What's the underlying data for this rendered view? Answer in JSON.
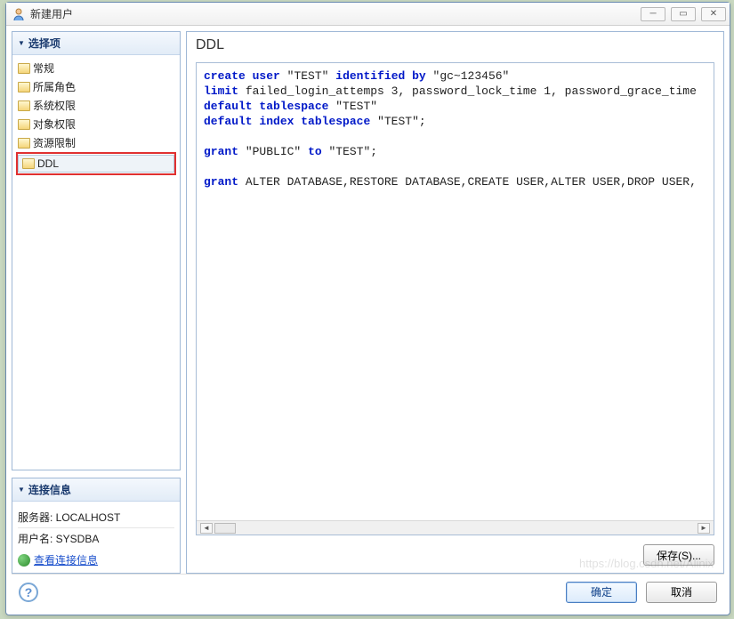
{
  "window": {
    "title": "新建用户"
  },
  "sidebar": {
    "options_title": "选择项",
    "items": [
      {
        "label": "常规"
      },
      {
        "label": "所属角色"
      },
      {
        "label": "系统权限"
      },
      {
        "label": "对象权限"
      },
      {
        "label": "资源限制"
      },
      {
        "label": "DDL"
      }
    ],
    "conn_title": "连接信息",
    "server_label": "服务器: LOCALHOST",
    "user_label": "用户名: SYSDBA",
    "view_conn_link": "查看连接信息"
  },
  "main": {
    "heading": "DDL",
    "code_tokens": [
      [
        {
          "t": "kw",
          "v": "create"
        },
        {
          "t": "sp"
        },
        {
          "t": "kw",
          "v": "user"
        },
        {
          "t": "sp"
        },
        {
          "t": "plain",
          "v": "\"TEST\""
        },
        {
          "t": "sp"
        },
        {
          "t": "kw",
          "v": "identified"
        },
        {
          "t": "sp"
        },
        {
          "t": "kw",
          "v": "by"
        },
        {
          "t": "sp"
        },
        {
          "t": "plain",
          "v": "\"gc~123456\""
        }
      ],
      [
        {
          "t": "kw",
          "v": "limit"
        },
        {
          "t": "sp"
        },
        {
          "t": "plain",
          "v": "failed_login_attemps 3, password_lock_time 1, password_grace_time"
        }
      ],
      [
        {
          "t": "kw",
          "v": "default"
        },
        {
          "t": "sp"
        },
        {
          "t": "kw",
          "v": "tablespace"
        },
        {
          "t": "sp"
        },
        {
          "t": "plain",
          "v": "\"TEST\""
        }
      ],
      [
        {
          "t": "kw",
          "v": "default"
        },
        {
          "t": "sp"
        },
        {
          "t": "kw",
          "v": "index"
        },
        {
          "t": "sp"
        },
        {
          "t": "kw",
          "v": "tablespace"
        },
        {
          "t": "sp"
        },
        {
          "t": "plain",
          "v": "\"TEST\";"
        }
      ],
      [],
      [
        {
          "t": "kw",
          "v": "grant"
        },
        {
          "t": "sp"
        },
        {
          "t": "plain",
          "v": "\"PUBLIC\""
        },
        {
          "t": "sp"
        },
        {
          "t": "kw",
          "v": "to"
        },
        {
          "t": "sp"
        },
        {
          "t": "plain",
          "v": "\"TEST\";"
        }
      ],
      [],
      [
        {
          "t": "kw",
          "v": "grant"
        },
        {
          "t": "sp"
        },
        {
          "t": "plain",
          "v": "ALTER DATABASE,RESTORE DATABASE,CREATE USER,ALTER USER,DROP USER,"
        }
      ]
    ],
    "save_label": "保存(S)..."
  },
  "footer": {
    "ok_label": "确定",
    "cancel_label": "取消"
  },
  "watermark": "https://blog.csdn.net/Alinix"
}
